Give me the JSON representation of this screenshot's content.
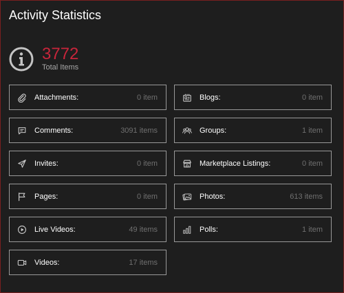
{
  "title": "Activity Statistics",
  "total": {
    "value": "3772",
    "label": "Total Items",
    "icon": "info-icon",
    "value_color": "#c8253b"
  },
  "stats": [
    {
      "label": "Attachments:",
      "count": "0 item",
      "icon": "paperclip-icon"
    },
    {
      "label": "Blogs:",
      "count": "0 item",
      "icon": "blog-icon"
    },
    {
      "label": "Comments:",
      "count": "3091 items",
      "icon": "comment-icon"
    },
    {
      "label": "Groups:",
      "count": "1 item",
      "icon": "groups-icon"
    },
    {
      "label": "Invites:",
      "count": "0 item",
      "icon": "send-icon"
    },
    {
      "label": "Marketplace Listings:",
      "count": "0 item",
      "icon": "store-icon"
    },
    {
      "label": "Pages:",
      "count": "0 item",
      "icon": "flag-icon"
    },
    {
      "label": "Photos:",
      "count": "613 items",
      "icon": "photos-icon"
    },
    {
      "label": "Live Videos:",
      "count": "49 items",
      "icon": "play-circle-icon"
    },
    {
      "label": "Polls:",
      "count": "1 item",
      "icon": "poll-icon"
    },
    {
      "label": "Videos:",
      "count": "17 items",
      "icon": "video-camera-icon"
    }
  ]
}
